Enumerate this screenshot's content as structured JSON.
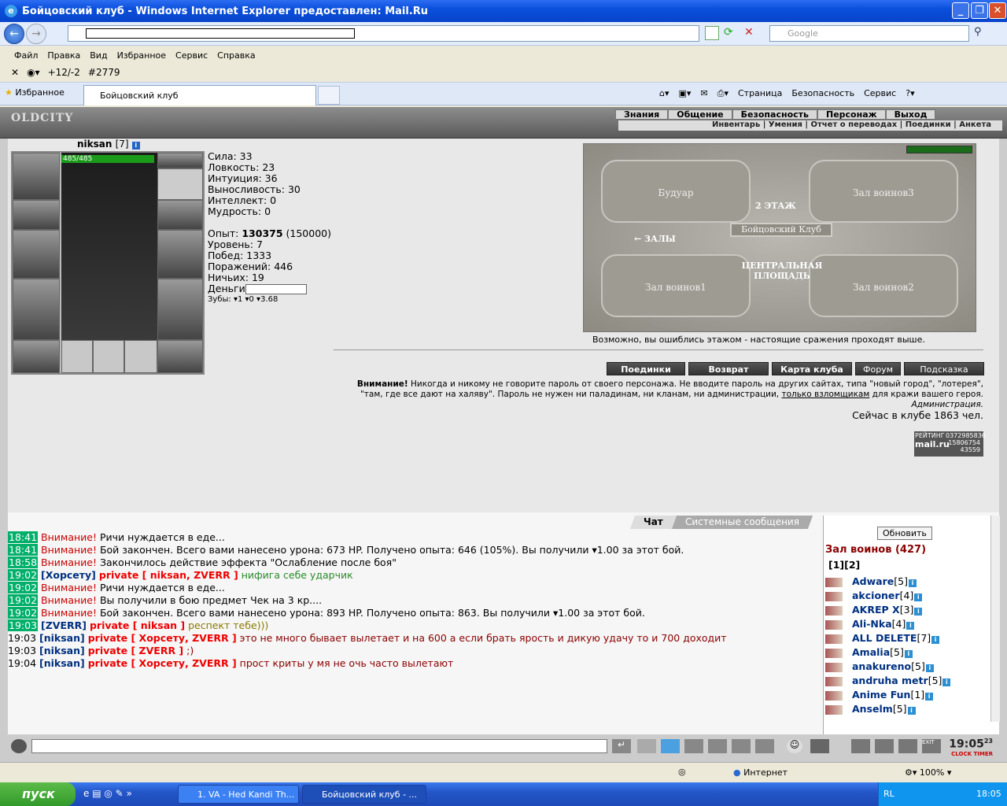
{
  "window": {
    "title": "Бойцовский клуб - Windows Internet Explorer предоставлен: Mail.Ru"
  },
  "ie": {
    "search_placeholder": "Google",
    "menu": [
      "Файл",
      "Правка",
      "Вид",
      "Избранное",
      "Сервис",
      "Справка"
    ],
    "links": {
      "rating": "+12/-2",
      "count": "#2779"
    },
    "favorites": "Избранное",
    "tab_title": "Бойцовский клуб",
    "commands": [
      "Страница",
      "Безопасность",
      "Сервис"
    ],
    "status_zone": "Интернет",
    "zoom": "100%"
  },
  "game": {
    "logo": "OLDCITY",
    "topnav": [
      "Знания",
      "Общение",
      "Безопасность",
      "Персонаж",
      "Выход"
    ],
    "subnav": "Инвентарь | Умения | Отчет о переводах | Поединки | Анкета",
    "character": {
      "name": "niksan",
      "level": "[7]",
      "hp": "485/485"
    },
    "stats": {
      "str": "Сила: 33",
      "agi": "Ловкость: 23",
      "int": "Интуиция: 36",
      "end": "Выносливость: 30",
      "intel": "Интеллект: 0",
      "wis": "Мудрость: 0",
      "exp_label": "Опыт: ",
      "exp": "130375",
      "exp_next": " (150000)",
      "lvl": "Уровень: 7",
      "wins": "Побед: 1333",
      "losses": "Поражений: 446",
      "draws": "Ничьих: 19",
      "money": "Деньги",
      "teeth": "Зубы: ▾1 ▾0 ▾3.68"
    },
    "map": {
      "rooms": [
        "Будуар",
        "Зал воинов3",
        "Зал воинов1",
        "Зал воинов2"
      ],
      "floor": "2 ЭТАЖ",
      "center": "Бойцовский Клуб",
      "halls": "← ЗАЛЫ",
      "plaza": "ЦЕНТРАЛЬНАЯ ПЛОЩАДЬ",
      "note": "Возможно, вы ошиблись этажом - настоящие сражения проходят выше."
    },
    "buttons": [
      "Поединки",
      "Возврат",
      "Карта клуба",
      "Форум",
      "Подсказка"
    ],
    "warning": {
      "bold": "Внимание!",
      "text": " Никогда и никому не говорите пароль от своего персонажа. Не вводите пароль на других сайтах, типа \"новый город\", \"лотерея\", \"там, где все дают на халяву\". Пароль не нужен ни паладинам, ни кланам, ни администрации, ",
      "link": "только взломщикам",
      "tail": " для кражи вашего героя.",
      "sign": "Администрация."
    },
    "online": "Сейчас в клубе 1863 чел.",
    "counter": {
      "label": "РЕЙТИНГ",
      "brand": "mail.ru",
      "n1": "0372985836",
      "n2": "15806754",
      "n3": "43559"
    }
  },
  "chat": {
    "tabs": [
      "Чат",
      "Системные сообщения"
    ],
    "lines": [
      {
        "t": "18:41",
        "a": "Внимание!",
        "b": " Ричи нуждается в еде..."
      },
      {
        "t": "18:41",
        "a": "Внимание!",
        "b": " Бой закончен. Всего вами нанесено урона: 673 HP. Получено опыта: 646 (105%). Вы получили ▾1.00 за этот бой."
      },
      {
        "t": "18:58",
        "a": "Внимание!",
        "b": " Закончилось действие эффекта \"Ослабление после боя\""
      },
      {
        "t": "19:02",
        "n": "[Хорсету]",
        "p": "private [ niksan, ZVERR ]",
        "m": " нифига себе ударчик"
      },
      {
        "t": "19:02",
        "a": "Внимание!",
        "b": " Ричи нуждается в еде..."
      },
      {
        "t": "19:02",
        "a": "Внимание!",
        "b": " Вы получили в бою предмет Чек на 3 кр...."
      },
      {
        "t": "19:02",
        "a": "Внимание!",
        "b": " Бой закончен. Всего вами нанесено урона: 893 HP. Получено опыта: 863. Вы получили ▾1.00 за этот бой."
      },
      {
        "t": "19:03",
        "n": "[ZVERR]",
        "p": "private [ niksan ]",
        "m": " респект тебе)))"
      },
      {
        "t": "19:03",
        "n": "[niksan]",
        "p": "private [ Хорсету, ZVERR ]",
        "m": " это не много бывает вылетает и на 600 а если брать ярость и дикую удачу то и 700 доходит"
      },
      {
        "t": "19:03",
        "n": "[niksan]",
        "p": "private [ ZVERR ]",
        "m": " ;)"
      },
      {
        "t": "19:04",
        "n": "[niksan]",
        "p": "private [ Хорсету, ZVERR ]",
        "m": " прост криты у мя не очь часто вылетают"
      }
    ],
    "refresh": "Обновить",
    "room": "Зал воинов (427)",
    "pages": "[1][2]",
    "users": [
      {
        "n": "Adware",
        "l": "[5]"
      },
      {
        "n": "akcioner",
        "l": "[4]"
      },
      {
        "n": "AKREP X",
        "l": "[3]"
      },
      {
        "n": "Ali-Nka",
        "l": "[4]"
      },
      {
        "n": "ALL DELETE",
        "l": "[7]"
      },
      {
        "n": "Amalia",
        "l": "[5]"
      },
      {
        "n": "anakureno",
        "l": "[5]"
      },
      {
        "n": "andruha metr",
        "l": "[5]"
      },
      {
        "n": "Anime Fun",
        "l": "[1]"
      },
      {
        "n": "Anselm",
        "l": "[5]"
      }
    ],
    "clock": "19:05",
    "clock_sec": "23",
    "clock_labels": "CLOCK TIMER"
  },
  "taskbar": {
    "start": "пуск",
    "tasks": [
      "1. VA - Hed Kandi Th...",
      "Бойцовский клуб - ..."
    ],
    "lang": "RL",
    "time": "18:05"
  }
}
